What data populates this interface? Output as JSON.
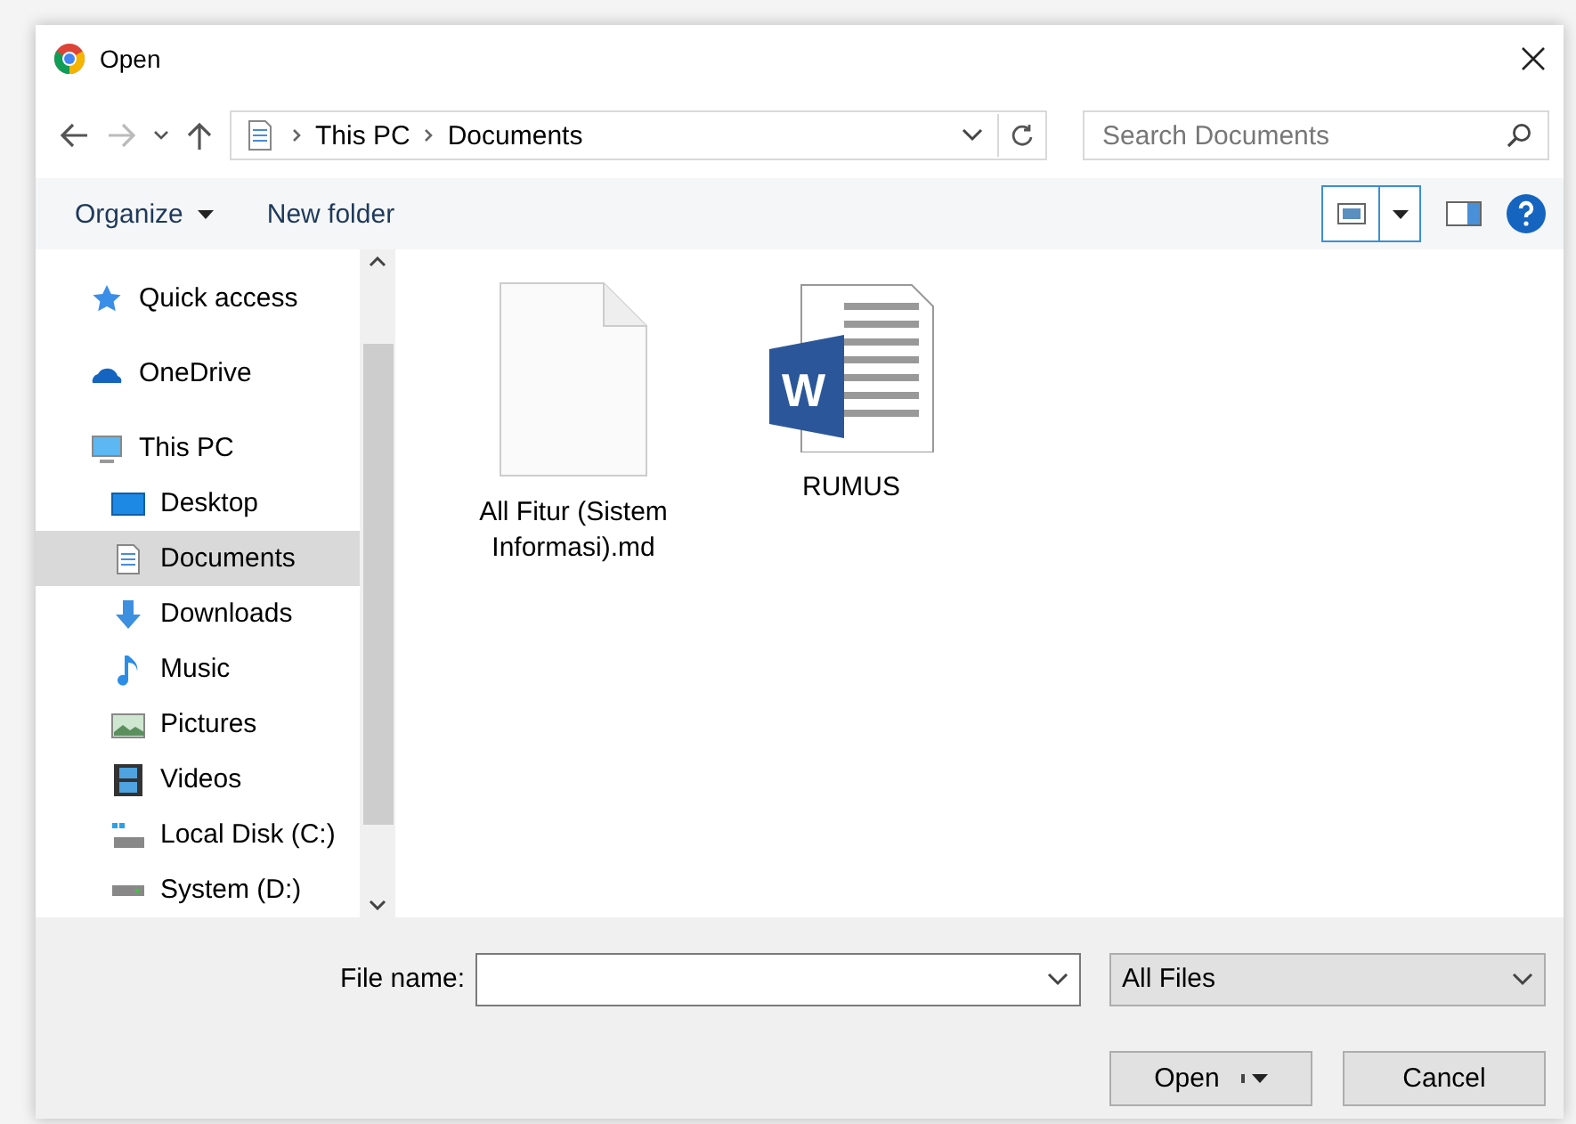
{
  "window": {
    "title": "Open"
  },
  "address": {
    "crumbs": [
      "This PC",
      "Documents"
    ]
  },
  "search": {
    "placeholder": "Search Documents"
  },
  "toolbar": {
    "buttons": [
      "Organize",
      "New folder"
    ]
  },
  "sidebar": {
    "items": [
      {
        "label": "Quick access",
        "selected": false
      },
      {
        "label": "OneDrive",
        "selected": false
      },
      {
        "label": "This PC",
        "selected": false,
        "children": [
          {
            "label": "Desktop",
            "selected": false
          },
          {
            "label": "Documents",
            "selected": true
          },
          {
            "label": "Downloads",
            "selected": false
          },
          {
            "label": "Music",
            "selected": false
          },
          {
            "label": "Pictures",
            "selected": false
          },
          {
            "label": "Videos",
            "selected": false
          },
          {
            "label": "Local Disk (C:)",
            "selected": false
          },
          {
            "label": "System (D:)",
            "selected": false
          }
        ]
      }
    ]
  },
  "files": [
    {
      "name": "All Fitur (Sistem Informasi).md",
      "kind": "text"
    },
    {
      "name": "RUMUS",
      "kind": "word",
      "badge": "W"
    }
  ],
  "footer": {
    "file_name_label": "File name:",
    "file_type": "All Files",
    "buttons": [
      "Open",
      "Cancel"
    ]
  }
}
